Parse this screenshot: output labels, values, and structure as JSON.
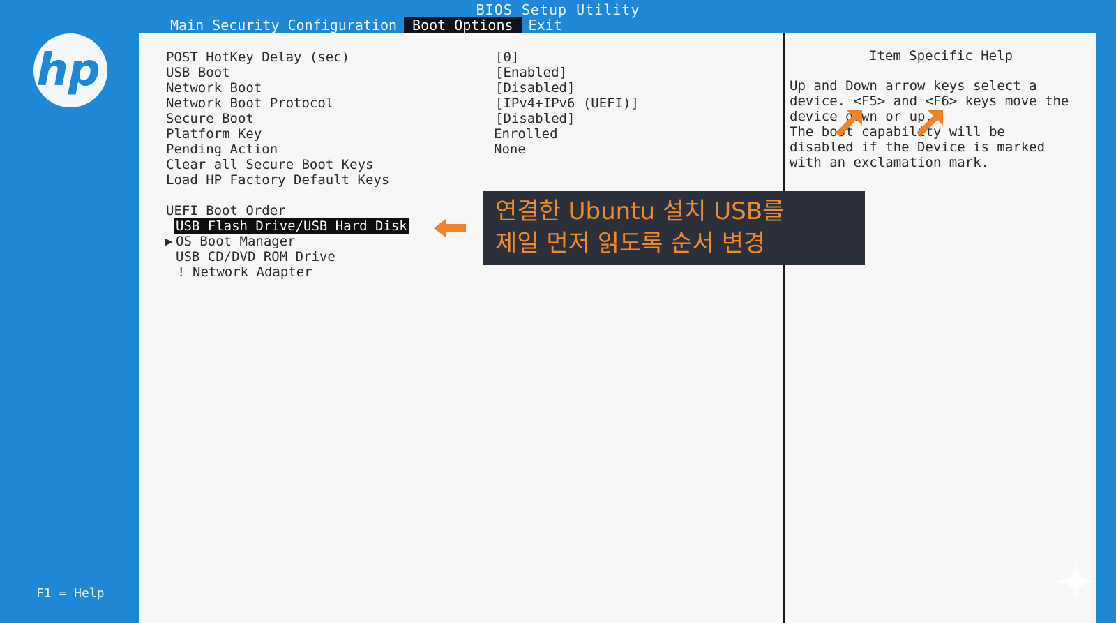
{
  "window": {
    "title": "BIOS Setup Utility"
  },
  "menu": {
    "items": [
      {
        "label": "Main"
      },
      {
        "label": "Security"
      },
      {
        "label": "Configuration"
      },
      {
        "label": "Boot Options"
      },
      {
        "label": "Exit"
      }
    ],
    "active": "Boot Options"
  },
  "logo": {
    "name": "hp-logo",
    "text": "hp"
  },
  "footer": {
    "help_key": "F1 = Help"
  },
  "settings": [
    {
      "label": "POST HotKey Delay (sec)",
      "value": "[0]"
    },
    {
      "label": "USB Boot",
      "value": "[Enabled]"
    },
    {
      "label": "Network Boot",
      "value": "[Disabled]"
    },
    {
      "label": "Network Boot Protocol",
      "value": "[IPv4+IPv6 (UEFI)]"
    },
    {
      "label": "Secure Boot",
      "value": "[Disabled]"
    },
    {
      "label": "Platform Key",
      "value": "Enrolled"
    },
    {
      "label": "Pending Action",
      "value": "None"
    },
    {
      "label": "Clear all Secure Boot Keys",
      "value": ""
    },
    {
      "label": "Load HP Factory Default Keys",
      "value": ""
    }
  ],
  "boot_order": {
    "heading": "UEFI Boot Order",
    "items": [
      {
        "label": "USB Flash Drive/USB Hard Disk",
        "selected": true
      },
      {
        "label": "OS Boot Manager",
        "marker": "▶"
      },
      {
        "label": "USB CD/DVD ROM Drive"
      },
      {
        "label": "Network Adapter",
        "marker": "!"
      }
    ]
  },
  "help": {
    "title": "Item Specific Help",
    "lines": [
      "Up and Down arrow keys select a",
      "device. <F5> and <F6> keys move the",
      "device down or up.",
      "The boot capability will be",
      "disabled if the Device is marked",
      "with an exclamation mark."
    ]
  },
  "annotation": {
    "lines": [
      "연결한 Ubuntu 설치 USB를",
      "제일 먼저 읽도록 순서 변경"
    ],
    "color": "#f08a2e",
    "background": "#2c303b"
  },
  "colors": {
    "bios_blue": "#1e88d6",
    "panel": "#f7f7f7",
    "highlight": "#0f0f0f",
    "arrow": "#f0822a"
  }
}
